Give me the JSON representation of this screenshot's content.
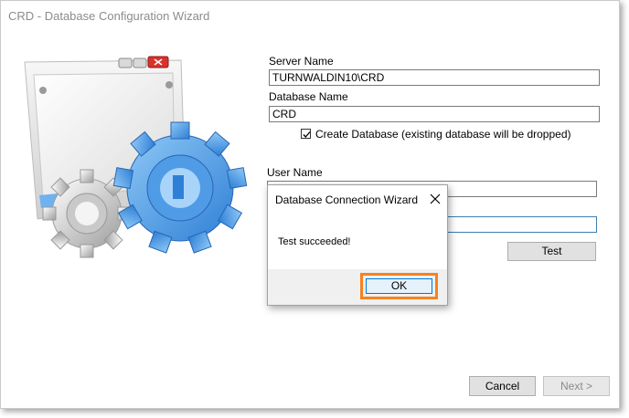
{
  "window": {
    "title": "CRD - Database Configuration Wizard"
  },
  "form": {
    "server_name_label": "Server Name",
    "server_name_value": "TURNWALDIN10\\CRD",
    "database_name_label": "Database Name",
    "database_name_value": "CRD",
    "create_database_label": "Create Database (existing database will be dropped)",
    "create_database_checked": true,
    "user_name_label": "User Name",
    "user_name_value": "",
    "password_value": "",
    "test_button": "Test"
  },
  "dialog": {
    "title": "Database Connection Wizard",
    "message": "Test succeeded!",
    "ok_button": "OK",
    "highlight_color": "#f58220"
  },
  "footer": {
    "cancel_button": "Cancel",
    "next_button": "Next >"
  },
  "icons": {
    "illustration": "window-with-gears-illustration",
    "close": "close-icon",
    "check": "checkmark-icon"
  }
}
